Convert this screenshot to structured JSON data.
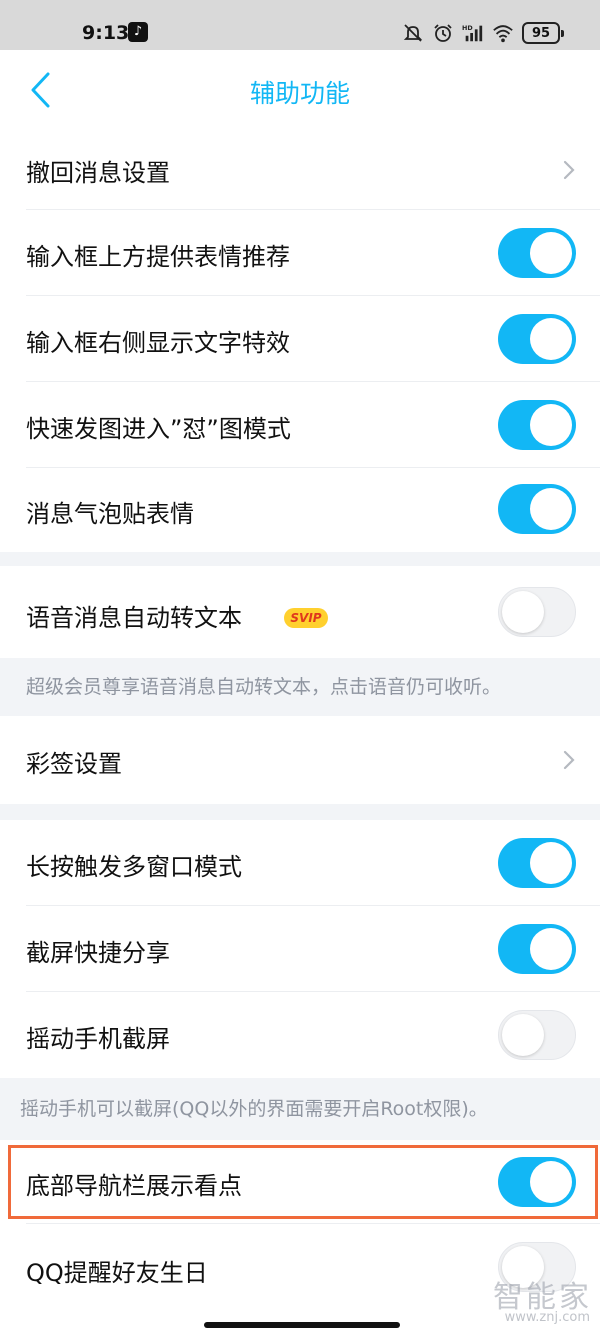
{
  "status_bar": {
    "time": "9:13",
    "battery": "95",
    "icons": [
      "tiktok-icon",
      "mute-icon",
      "alarm-icon",
      "hd-signal-icon",
      "wifi-icon",
      "battery-icon"
    ]
  },
  "nav": {
    "title": "辅助功能",
    "back_icon": "chevron-left-icon"
  },
  "rows": {
    "recall": {
      "label": "撤回消息设置"
    },
    "emoji_rec": {
      "label": "输入框上方提供表情推荐",
      "on": true
    },
    "text_effect": {
      "label": "输入框右侧显示文字特效",
      "on": true
    },
    "fast_img": {
      "label": "快速发图进入”怼”图模式",
      "on": true
    },
    "bubble": {
      "label": "消息气泡贴表情",
      "on": true
    },
    "voice2text": {
      "label": "语音消息自动转文本",
      "badge": "SVIP",
      "on": false
    },
    "caiqian": {
      "label": "彩签设置"
    },
    "multiwin": {
      "label": "长按触发多窗口模式",
      "on": true
    },
    "screenshot_share": {
      "label": "截屏快捷分享",
      "on": true
    },
    "shake_shot": {
      "label": "摇动手机截屏",
      "on": false
    },
    "nav_kandian": {
      "label": "底部导航栏展示看点",
      "on": true
    },
    "birthday": {
      "label": "QQ提醒好友生日",
      "on": false
    }
  },
  "notes": {
    "voice": "超级会员尊享语音消息自动转文本，点击语音仍可收听。",
    "shake": "摇动手机可以截屏(QQ以外的界面需要开启Root权限)。"
  },
  "watermark": {
    "logo": "智能家",
    "url": "www.znj.com"
  },
  "colors": {
    "accent": "#12b7f5",
    "highlight": "#f06a3a",
    "svip_bg": "#ffd02e",
    "svip_text": "#e0381d"
  }
}
